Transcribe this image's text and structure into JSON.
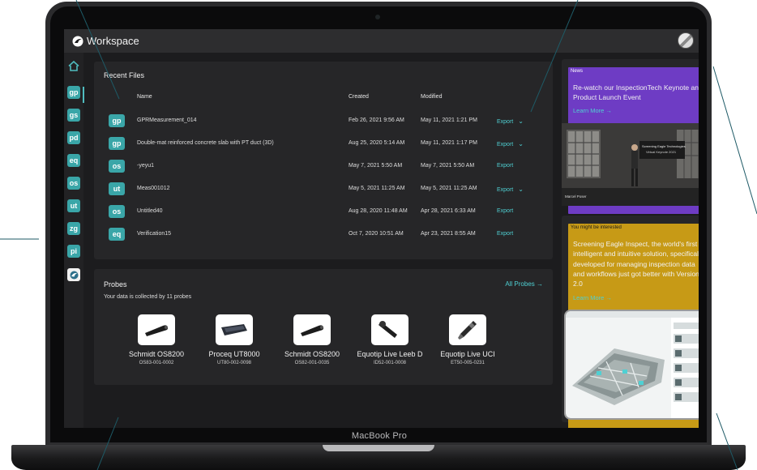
{
  "device": {
    "brand": "MacBook Pro"
  },
  "app": {
    "title": "Workspace"
  },
  "sidebar": {
    "items": [
      {
        "label": "",
        "icon": "home-icon"
      },
      {
        "label": "gp"
      },
      {
        "label": "gs"
      },
      {
        "label": "pd"
      },
      {
        "label": "eq"
      },
      {
        "label": "os"
      },
      {
        "label": "ut"
      },
      {
        "label": "zg"
      },
      {
        "label": "pi"
      },
      {
        "label": "",
        "icon": "eagle-icon"
      }
    ]
  },
  "recent_files": {
    "title": "Recent Files",
    "columns": {
      "name": "Name",
      "created": "Created",
      "modified": "Modified"
    },
    "rows": [
      {
        "icon": "gp",
        "name": "GPRMeasurement_014",
        "created": "Feb 26, 2021 9:56 AM",
        "modified": "May 11, 2021 1:21 PM",
        "action": "Export",
        "has_menu": true
      },
      {
        "icon": "gp",
        "name": "Double-mat reinforced concrete slab with PT duct (3D)",
        "created": "Aug 25, 2020 5:14 AM",
        "modified": "May 11, 2021 1:17 PM",
        "action": "Export",
        "has_menu": true
      },
      {
        "icon": "os",
        "name": "-yeyu1",
        "created": "May 7, 2021 5:50 AM",
        "modified": "May 7, 2021 5:50 AM",
        "action": "Export",
        "has_menu": false
      },
      {
        "icon": "ut",
        "name": "Meas001012",
        "created": "May 5, 2021 11:25 AM",
        "modified": "May 5, 2021 11:25 AM",
        "action": "Export",
        "has_menu": true
      },
      {
        "icon": "os",
        "name": "Untitled40",
        "created": "Aug 28, 2020 11:48 AM",
        "modified": "Apr 28, 2021 6:33 AM",
        "action": "Export",
        "has_menu": false
      },
      {
        "icon": "eq",
        "name": "Verification15",
        "created": "Oct 7, 2020 10:51 AM",
        "modified": "Apr 23, 2021 8:55 AM",
        "action": "Export",
        "has_menu": false
      }
    ]
  },
  "probes": {
    "title": "Probes",
    "subtitle": "Your data is collected by 11 probes",
    "all_label": "All Probes →",
    "items": [
      {
        "name": "Schmidt OS8200",
        "serial": "OS83-001-0002"
      },
      {
        "name": "Proceq UT8000",
        "serial": "UT80-002-0098"
      },
      {
        "name": "Schmidt OS8200",
        "serial": "OS82-001-0035"
      },
      {
        "name": "Equotip Live Leeb D",
        "serial": "ID52-001-0008"
      },
      {
        "name": "Equotip Live UCI",
        "serial": "ET50-005-0231"
      }
    ]
  },
  "news": {
    "badge": "News",
    "headline": "Re-watch our InspectionTech Keynote and Product Launch Event",
    "learn_more": "Learn More →",
    "video_caption": "Screening Eagle Technologies",
    "video_subcaption": "Virtual Keynote 2021",
    "speaker": "Marcel Poser"
  },
  "interest": {
    "badge": "You might be interested",
    "text": "Screening Eagle Inspect, the world's first intelligent and intuitive solution, specifically developed for managing inspection data and workflows just got better with Version 2.0",
    "learn_more": "Learn More →"
  },
  "colors": {
    "accent": "#4fd0d3",
    "icon_tile": "#3aa6a8",
    "news_badge": "#6e3cc4",
    "interest_badge": "#c79a16",
    "panel": "#262628",
    "background": "#1c1c1e"
  }
}
